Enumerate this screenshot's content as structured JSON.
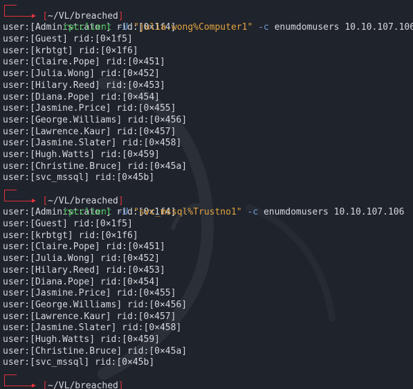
{
  "terminal": {
    "blocks": [
      {
        "prompt": {
          "open": "[",
          "path": "~/VL/breached",
          "close": "]"
        },
        "command": {
          "tool": "rpcclient",
          "flag_user": "-U",
          "credential": "\"julia.wong%Computer1\"",
          "flag_cmd": "-c",
          "rest": "enumdomusers 10.10.107.106"
        },
        "output": [
          "user:[Administrator] rid:[0×1f4]",
          "user:[Guest] rid:[0×1f5]",
          "user:[krbtgt] rid:[0×1f6]",
          "user:[Claire.Pope] rid:[0×451]",
          "user:[Julia.Wong] rid:[0×452]",
          "user:[Hilary.Reed] rid:[0×453]",
          "user:[Diana.Pope] rid:[0×454]",
          "user:[Jasmine.Price] rid:[0×455]",
          "user:[George.Williams] rid:[0×456]",
          "user:[Lawrence.Kaur] rid:[0×457]",
          "user:[Jasmine.Slater] rid:[0×458]",
          "user:[Hugh.Watts] rid:[0×459]",
          "user:[Christine.Bruce] rid:[0×45a]",
          "user:[svc_mssql] rid:[0×45b]"
        ]
      },
      {
        "prompt": {
          "open": "[",
          "path": "~/VL/breached",
          "close": "]"
        },
        "command": {
          "tool": "rpcclient",
          "flag_user": "-U",
          "credential": "\"svc_mssql%Trustno1\"",
          "flag_cmd": "-c",
          "rest": "enumdomusers 10.10.107.106"
        },
        "output": [
          "user:[Administrator] rid:[0×1f4]",
          "user:[Guest] rid:[0×1f5]",
          "user:[krbtgt] rid:[0×1f6]",
          "user:[Claire.Pope] rid:[0×451]",
          "user:[Julia.Wong] rid:[0×452]",
          "user:[Hilary.Reed] rid:[0×453]",
          "user:[Diana.Pope] rid:[0×454]",
          "user:[Jasmine.Price] rid:[0×455]",
          "user:[George.Williams] rid:[0×456]",
          "user:[Lawrence.Kaur] rid:[0×457]",
          "user:[Jasmine.Slater] rid:[0×458]",
          "user:[Hugh.Watts] rid:[0×459]",
          "user:[Christine.Bruce] rid:[0×45a]",
          "user:[svc_mssql] rid:[0×45b]"
        ]
      }
    ],
    "final_prompt": {
      "open": "[",
      "path": "~/VL/breached",
      "close": "]"
    }
  },
  "colors": {
    "background": "#1f232b",
    "prompt_red": "#e0333c",
    "tool_green": "#3fb950",
    "flag_blue": "#6d9cde",
    "string_orange": "#e2a341",
    "text": "#d6d8dc"
  },
  "icons": {
    "background": "kali-dragon-watermark",
    "cursor": "block-cursor"
  }
}
